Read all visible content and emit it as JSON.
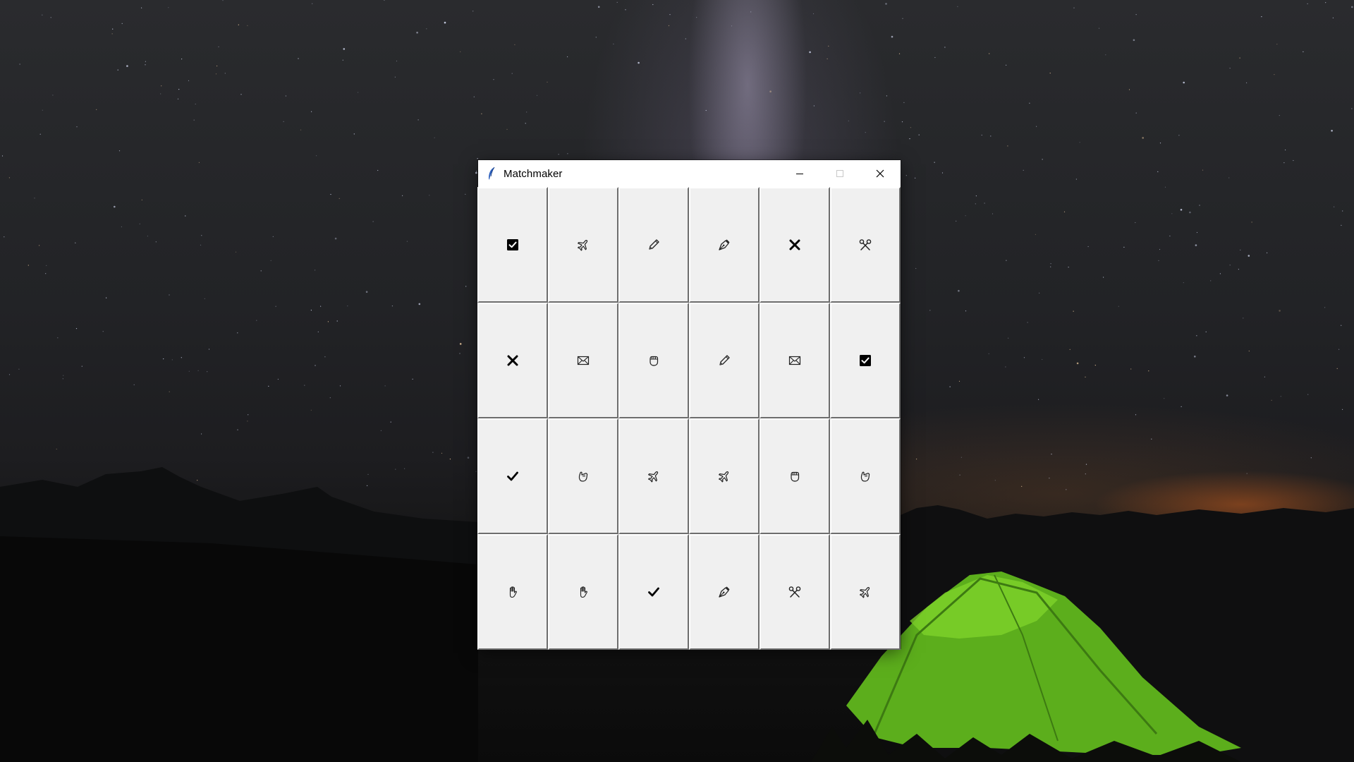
{
  "window": {
    "title": "Matchmaker",
    "app_icon": "feather-icon",
    "controls": [
      "minimize-icon",
      "maximize-icon",
      "close-icon"
    ]
  },
  "board": {
    "rows": 4,
    "columns": 6,
    "tiles": [
      [
        "check-box-icon",
        "airplane-icon",
        "pencil-icon",
        "pen-nib-icon",
        "cross-mark-icon",
        "scissors-icon"
      ],
      [
        "cross-mark-icon",
        "envelope-icon",
        "fist-icon",
        "pencil-icon",
        "envelope-icon",
        "check-box-icon"
      ],
      [
        "check-mark-icon",
        "hand-icon",
        "airplane-icon",
        "airplane-icon",
        "fist-icon",
        "hand-icon"
      ],
      [
        "raised-hand-icon",
        "raised-hand-icon",
        "check-mark-icon",
        "pen-nib-icon",
        "scissors-icon",
        "airplane-icon"
      ]
    ]
  }
}
